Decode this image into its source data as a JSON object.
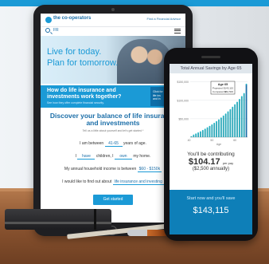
{
  "colors": {
    "brand_blue": "#1b9ad6",
    "dark_blue": "#1b6ea8",
    "footer_blue": "#0e7fb8",
    "bar_teal": "#2aa7b8"
  },
  "tablet": {
    "header": {
      "logo_text": "the co-operators",
      "find_advisor": "Find a Financial Advisor",
      "lang": "FR",
      "icons": [
        "search-icon",
        "menu-icon"
      ]
    },
    "hero": {
      "line1": "Live for today.",
      "line2": "Plan for tomorrow."
    },
    "banner": {
      "title": "How do life insurance and investments work together?",
      "subtitle": "See how they offer complete financial security.",
      "card_text": "Click for life ins and in",
      "icon": "play-arrow-icon"
    },
    "calculator": {
      "title_line1": "Discover your balance of life insurance",
      "title_line2": "and investments",
      "subtitle": "Tell us a little about yourself and let's get started *",
      "age_prefix": "I am between",
      "age_value": "41-65",
      "age_suffix": "years of age.",
      "children_prefix": "I",
      "children_value": "have",
      "children_mid": "children, I",
      "home_value": "own",
      "home_suffix": "my home.",
      "income_prefix": "My annual household income is between",
      "income_value": "$60 - $150k",
      "learn_prefix": "I would like to find out about",
      "learn_value": "life insurance and investing",
      "cta": "Get started"
    }
  },
  "phone": {
    "chart_title": "Total Annual Savings by Age 65",
    "contributing_label": "You'll be contributing",
    "contributing_amount": "$104.17",
    "per_pay": "per pay",
    "annual": "($2,500 annually)",
    "footer_label": "Start now and you'll save",
    "footer_amount": "$143,115"
  },
  "chart_data": {
    "type": "bar",
    "title": "Total Annual Savings by Age 65",
    "xlabel": "Age",
    "ylabel": "",
    "y_tick_labels": [
      "$150,000",
      "$100,000",
      "$50,000"
    ],
    "x_tick_labels": [
      "40",
      "50",
      "60"
    ],
    "ylim": [
      0,
      160000
    ],
    "categories": [
      "41",
      "42",
      "43",
      "44",
      "45",
      "46",
      "47",
      "48",
      "49",
      "50",
      "51",
      "52",
      "53",
      "54",
      "55",
      "56",
      "57",
      "58",
      "59",
      "60",
      "61",
      "62",
      "63",
      "64",
      "65"
    ],
    "values": [
      2600,
      5300,
      8200,
      11200,
      14400,
      17800,
      21300,
      25000,
      28900,
      33000,
      37300,
      41800,
      46600,
      51600,
      56900,
      62400,
      68200,
      74300,
      80700,
      87400,
      94400,
      101800,
      109600,
      117800,
      143115
    ],
    "tooltip": {
      "title": "Age 65",
      "rows": [
        {
          "label": "Projected",
          "value": "$143,115"
        },
        {
          "label": "Compared to",
          "value": "$62,500"
        }
      ]
    }
  }
}
